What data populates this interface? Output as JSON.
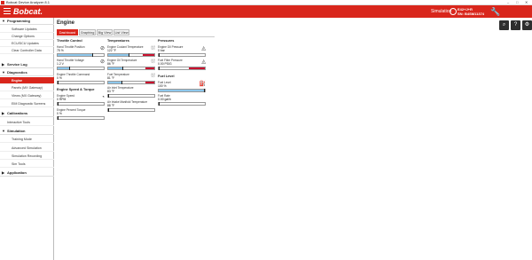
{
  "window": {
    "title": "Bobcat Device Analyzer 8.1",
    "controls": [
      "–",
      "□",
      "✕"
    ]
  },
  "header": {
    "logo": "Bobcat.",
    "mode": "Simulation",
    "equipment_line1": "E42+J+R",
    "equipment_line2": "SN: B4SM11374",
    "tools_icon": "wrench-icon"
  },
  "sidebar": {
    "sections": [
      {
        "label": "Programming",
        "expanded": true,
        "items": [
          "Software Updates",
          "Change Options",
          "ECU/DCU Updates",
          "Clear Controller Data"
        ]
      },
      {
        "label": "Service Log",
        "expanded": false,
        "items": []
      },
      {
        "label": "Diagnostics",
        "expanded": true,
        "items": [
          "Engine",
          "Panels (MX Gateway)",
          "Views (MX Gateway)",
          "EIM Diagnostic Screens"
        ],
        "active": "Engine"
      },
      {
        "label": "Calibrations",
        "expanded": false,
        "items": []
      },
      {
        "label": "Interactive Tools",
        "expanded": false,
        "items": []
      },
      {
        "label": "Simulation",
        "expanded": true,
        "items": [
          "Training Mode",
          "Advanced Simulation",
          "Simulation Recording",
          "Sim Tools"
        ]
      },
      {
        "label": "Application",
        "expanded": false,
        "items": []
      }
    ]
  },
  "main": {
    "title": "Engine",
    "toolbar_icons": [
      "search-icon",
      "help-icon",
      "gear-icon"
    ],
    "tabs": [
      {
        "label": "Dashboard",
        "active": true
      },
      {
        "label": "Graphing",
        "active": false
      },
      {
        "label": "Big View",
        "active": false
      },
      {
        "label": "List View",
        "active": false
      }
    ],
    "groups": {
      "throttle": {
        "title": "Throttle Control",
        "gauges": [
          {
            "label": "Hand Throttle Position",
            "value": "75 %",
            "icon": "throttle-icon",
            "fill": 0.75
          },
          {
            "label": "Hand Throttle Voltage",
            "value": "1.2 V",
            "icon": "voltage-icon",
            "fill": 0.25
          },
          {
            "label": "Engine Throttle Command",
            "value": "0 %",
            "icon": "",
            "fill": 0.0
          }
        ]
      },
      "speed": {
        "title": "Engine Speed & Torque",
        "gauges": [
          {
            "label": "Engine Speed",
            "value": "0 RPM",
            "icon": "speed-icon",
            "fill": 0.0
          },
          {
            "label": "Engine Percent Torque",
            "value": "0 %",
            "icon": "",
            "fill": 0.0
          }
        ]
      },
      "temperatures": {
        "title": "Temperatures",
        "gauges": [
          {
            "label": "Engine Coolant Temperature",
            "value": "122 °F",
            "icon": "coolant-icon",
            "fill": 0.45,
            "redzone": 0.25
          },
          {
            "label": "Engine Oil Temperature",
            "value": "86 °F",
            "icon": "oil-temp-icon",
            "fill": 0.3,
            "redzone": 0.2
          },
          {
            "label": "Fuel Temperature",
            "value": "81 °F",
            "icon": "fuel-temp-icon",
            "fill": 0.28,
            "redzone": 0.2
          },
          {
            "label": "Air Inlet Temperature",
            "value": "83 °F",
            "icon": "",
            "fill": 0.0
          },
          {
            "label": "Air Intake Manifold Temperature",
            "value": "88 °F",
            "icon": "",
            "fill": 0.0
          }
        ]
      },
      "pressures": {
        "title": "Pressures",
        "gauges": [
          {
            "label": "Engine Oil Pressure",
            "value": "0 bar",
            "icon": "oil-pressure-icon",
            "fill": 0.0
          },
          {
            "label": "Fuel Filter Pressure",
            "value": "0.00 PSIG",
            "icon": "fuel-filter-icon",
            "fill": 0.0,
            "redzone": 0.35
          }
        ]
      },
      "fuel": {
        "title": "Fuel Level",
        "gauges": [
          {
            "label": "Fuel Level",
            "value": "100 %",
            "icon": "fuel-pump-icon",
            "fill": 1.0,
            "fill_color": "#8ec8ec"
          },
          {
            "label": "Fuel Rate",
            "value": "0.00 gal/h",
            "icon": "",
            "fill": 0.0
          }
        ]
      }
    }
  },
  "colors": {
    "accent": "#d9261c",
    "fill": "#8ec8ec",
    "danger": "#c8102e",
    "dark": "#2e2e2e"
  }
}
